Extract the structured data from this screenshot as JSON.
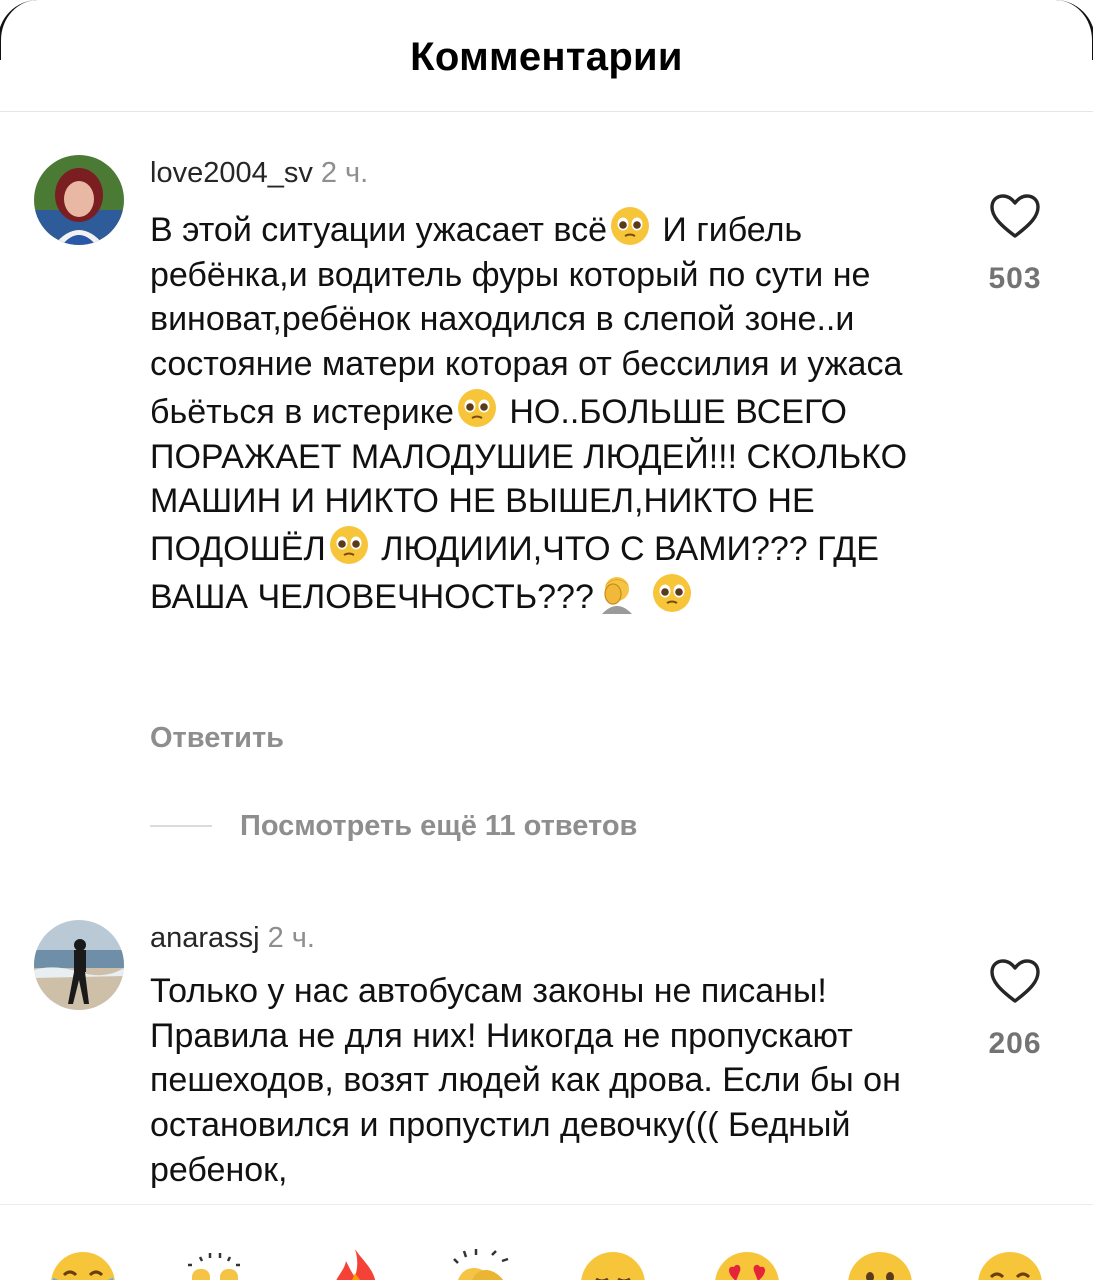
{
  "header": {
    "title": "Комментарии"
  },
  "comments": [
    {
      "username": "love2004_sv",
      "time": "2 ч.",
      "segments": [
        "В этой ситуации ужасает всё",
        " И гибель ребёнка,и водитель фуры который по сути не виноват,ребёнок находился в слепой зоне..и состояние матери которая от бессилия и ужаса бьёться в истерике",
        " НО..БОЛЬШЕ ВСЕГО ПОРАЖАЕТ МАЛОДУШИЕ ЛЮДЕЙ!!! СКОЛЬКО МАШИН И НИКТО НЕ ВЫШЕЛ,НИКТО НЕ ПОДОШЁЛ",
        " ЛЮДИИИ,ЧТО С ВАМИ??? ГДЕ ВАША ЧЕЛОВЕЧНОСТЬ???",
        " "
      ],
      "likes": "503",
      "reply_label": "Ответить"
    },
    {
      "username": "anarassj",
      "time": "2 ч.",
      "text": "Только у нас автобусам законы не писаны! Правила не для них! Никогда не пропускают пешеходов, возят людей как дрова. Если бы он остановился и пропустил девочку((( Бедный ребенок,",
      "likes": "206"
    }
  ],
  "more_replies": "Посмотреть ещё 11 ответов",
  "emoji_bar": [
    "face-with-tears-of-joy",
    "raising-hands",
    "fire",
    "clapping-hands",
    "crying-face",
    "heart-eyes",
    "astonished-face",
    "grinning-face"
  ],
  "colors": {
    "text": "#111111",
    "muted": "#8e8e8e",
    "like_count": "#737373"
  }
}
